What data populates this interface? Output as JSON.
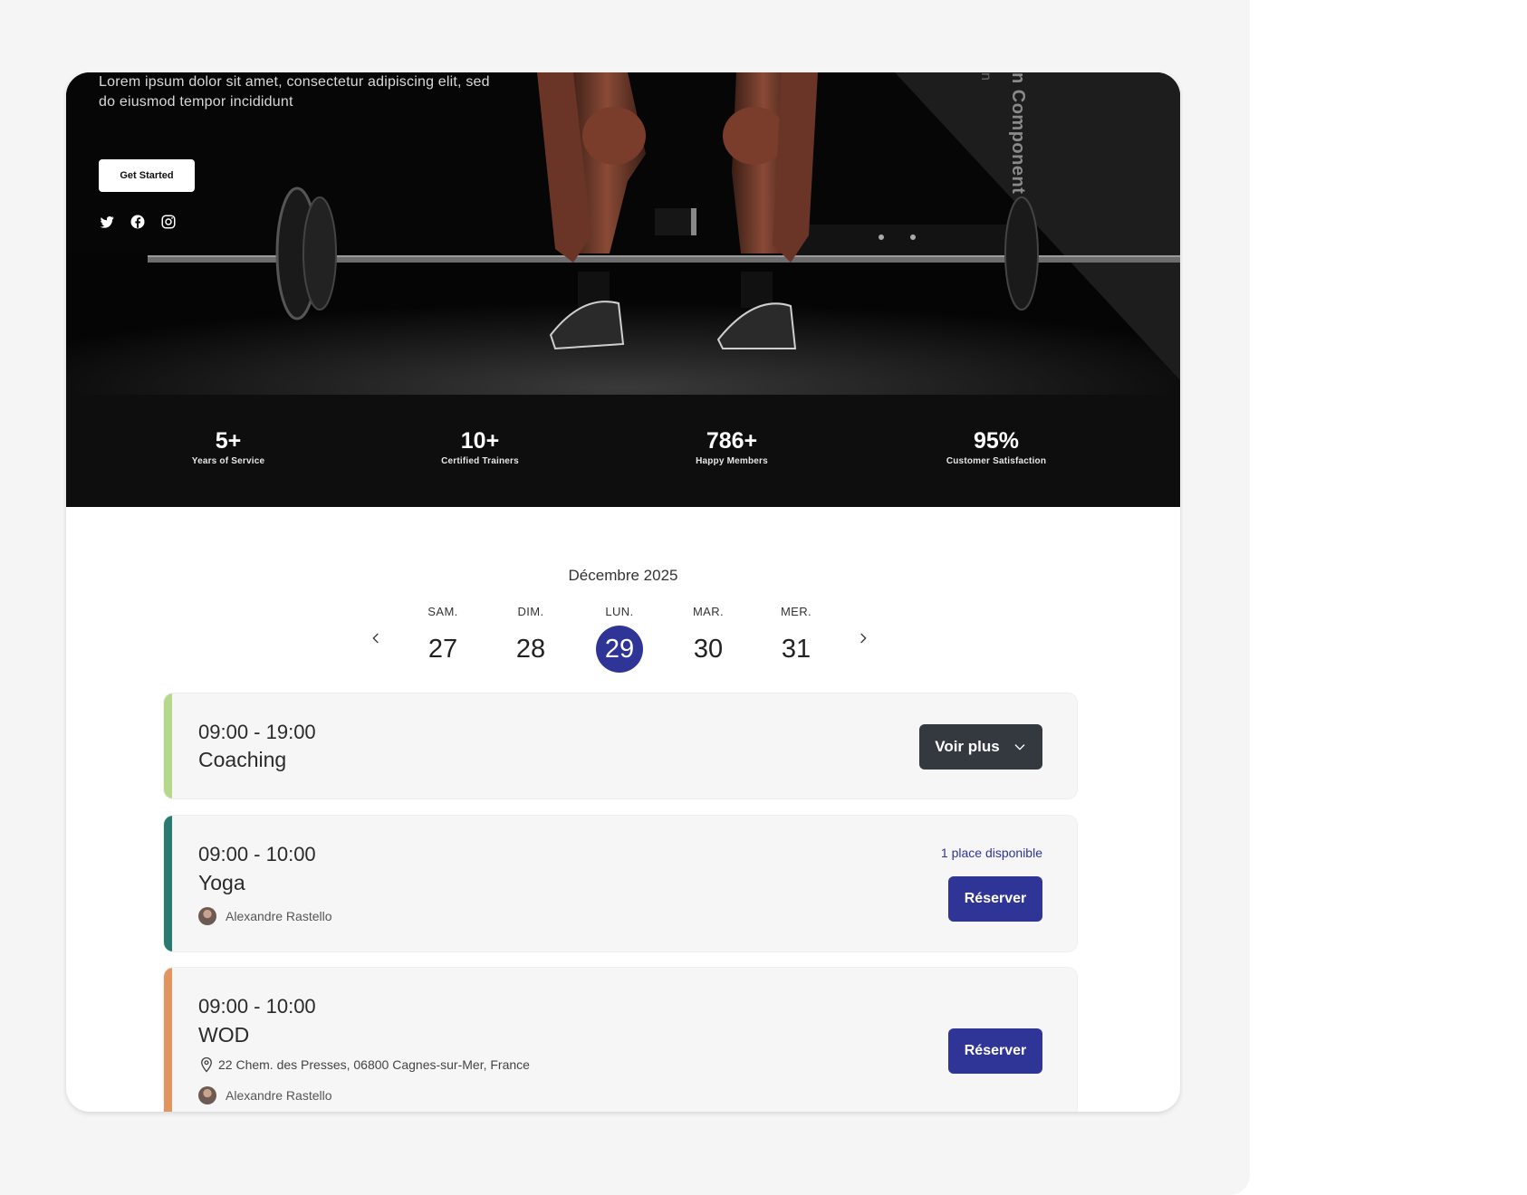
{
  "hero": {
    "description": "Lorem ipsum dolor sit amet, consectetur adipiscing elit, sed do eiusmod tempor incididunt",
    "cta_label": "Get Started",
    "vertical_label": "n Component",
    "social_icons": [
      "twitter-icon",
      "facebook-icon",
      "instagram-icon"
    ]
  },
  "stats": [
    {
      "value": "5+",
      "label": "Years of Service"
    },
    {
      "value": "10+",
      "label": "Certified Trainers"
    },
    {
      "value": "786+",
      "label": "Happy Members"
    },
    {
      "value": "95%",
      "label": "Customer Satisfaction"
    }
  ],
  "calendar": {
    "month": "Décembre 2025",
    "days": [
      {
        "name": "SAM.",
        "date": "27"
      },
      {
        "name": "DIM.",
        "date": "28"
      },
      {
        "name": "LUN.",
        "date": "29",
        "selected": true
      },
      {
        "name": "MAR.",
        "date": "30"
      },
      {
        "name": "MER.",
        "date": "31"
      }
    ]
  },
  "events": [
    {
      "time": "09:00 - 19:00",
      "title": "Coaching",
      "accent": "#b5d98a",
      "button": "Voir plus"
    },
    {
      "time": "09:00 - 10:00",
      "title": "Yoga",
      "accent": "#2b7a72",
      "trainer": "Alexandre Rastello",
      "availability": "1 place disponible",
      "button": "Réserver"
    },
    {
      "time": "09:00 - 10:00",
      "title": "WOD",
      "accent": "#e0965e",
      "address": "22 Chem. des Presses, 06800 Cagnes-sur-Mer, France",
      "trainer": "Alexandre Rastello",
      "button": "Réserver"
    }
  ],
  "colors": {
    "primary": "#2f3597",
    "dark_button": "#34383f",
    "hero_bg": "#070707"
  }
}
